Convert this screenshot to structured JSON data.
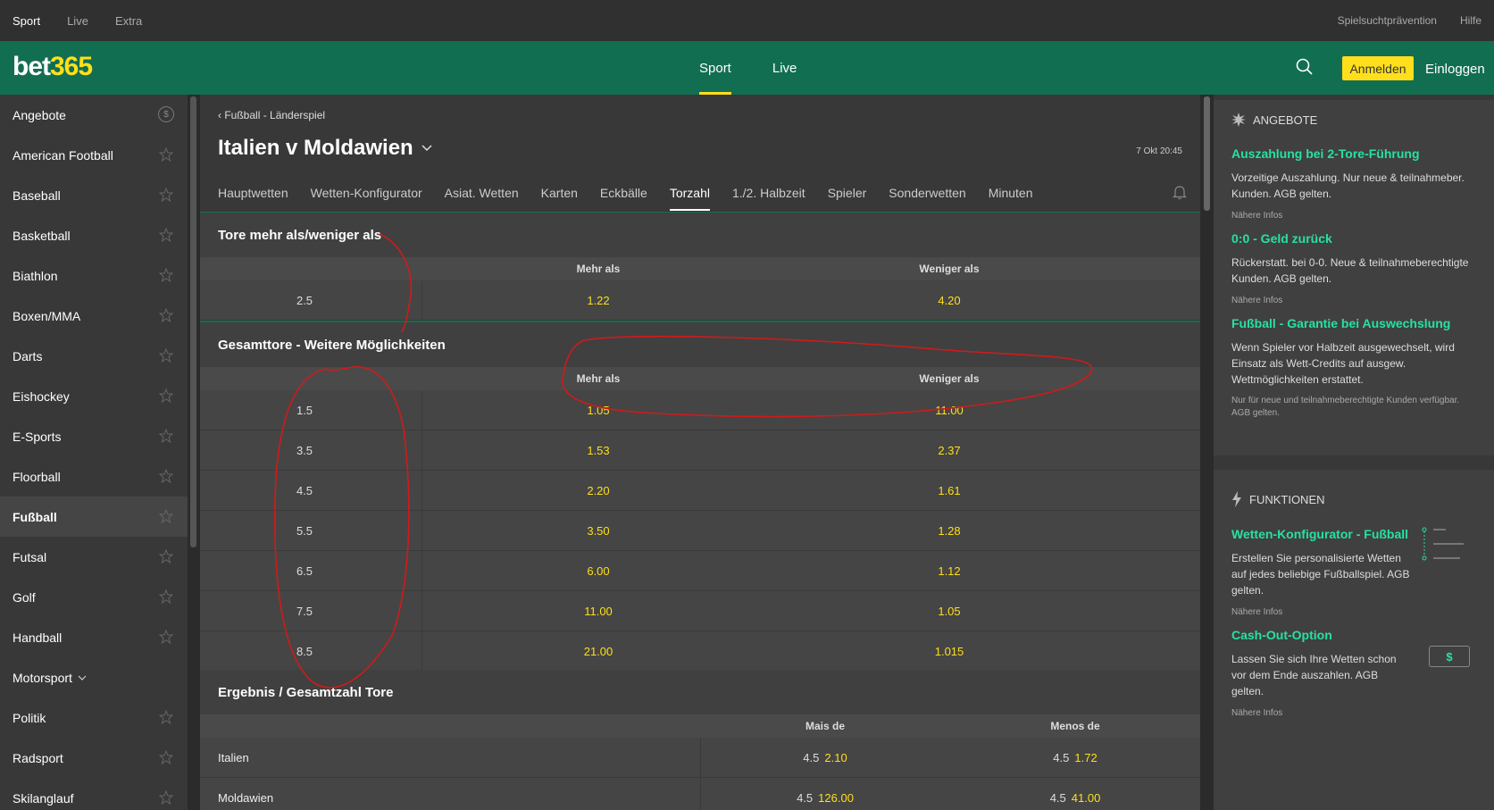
{
  "topbar": {
    "left": [
      "Sport",
      "Live",
      "Extra"
    ],
    "right": [
      "Spielsuchtprävention",
      "Hilfe"
    ]
  },
  "header": {
    "logo_a": "bet",
    "logo_b": "365",
    "nav": [
      "Sport",
      "Live"
    ],
    "register_label": "Anmelden",
    "login_label": "Einloggen"
  },
  "sidebar": {
    "items": [
      "Angebote",
      "American Football",
      "Baseball",
      "Basketball",
      "Biathlon",
      "Boxen/MMA",
      "Darts",
      "Eishockey",
      "E-Sports",
      "Floorball",
      "Fußball",
      "Futsal",
      "Golf",
      "Handball",
      "Motorsport",
      "Politik",
      "Radsport",
      "Skilanglauf"
    ],
    "offers_badge": "$"
  },
  "main": {
    "breadcrumb": "Fußball - Länderspiel",
    "title": "Italien v Moldawien",
    "time": "7 Okt 20:45",
    "tabs": [
      "Hauptwetten",
      "Wetten-Konfigurator",
      "Asiat. Wetten",
      "Karten",
      "Eckbälle",
      "Torzahl",
      "1./2. Halbzeit",
      "Spieler",
      "Sonderwetten",
      "Minuten"
    ]
  },
  "market1": {
    "title": "Tore mehr als/weniger als",
    "col_over": "Mehr als",
    "col_under": "Weniger als",
    "rows": [
      {
        "line": "2.5",
        "over": "1.22",
        "under": "4.20"
      }
    ]
  },
  "market2": {
    "title": "Gesamttore - Weitere Möglichkeiten",
    "col_over": "Mehr als",
    "col_under": "Weniger als",
    "rows": [
      {
        "line": "1.5",
        "over": "1.05",
        "under": "11.00"
      },
      {
        "line": "3.5",
        "over": "1.53",
        "under": "2.37"
      },
      {
        "line": "4.5",
        "over": "2.20",
        "under": "1.61"
      },
      {
        "line": "5.5",
        "over": "3.50",
        "under": "1.28"
      },
      {
        "line": "6.5",
        "over": "6.00",
        "under": "1.12"
      },
      {
        "line": "7.5",
        "over": "11.00",
        "under": "1.05"
      },
      {
        "line": "8.5",
        "over": "21.00",
        "under": "1.015"
      }
    ]
  },
  "market3": {
    "title": "Ergebnis / Gesamtzahl Tore",
    "col_over": "Mais de",
    "col_under": "Menos de",
    "rows": [
      {
        "team": "Italien",
        "over_h": "4.5",
        "over_o": "2.10",
        "under_h": "4.5",
        "under_o": "1.72"
      },
      {
        "team": "Moldawien",
        "over_h": "4.5",
        "over_o": "126.00",
        "under_h": "4.5",
        "under_o": "41.00"
      }
    ]
  },
  "right": {
    "offers_heading": "ANGEBOTE",
    "offers": [
      {
        "title": "Auszahlung bei 2-Tore-Führung",
        "desc": "Vorzeitige Auszahlung. Nur neue & teilnahmeber. Kunden. AGB gelten.",
        "more": "Nähere Infos"
      },
      {
        "title": "0:0 - Geld zurück",
        "desc": "Rückerstatt. bei 0-0. Neue & teilnahmeberechtigte Kunden. AGB gelten.",
        "more": "Nähere Infos"
      },
      {
        "title": "Fußball - Garantie bei Auswechslung",
        "desc": "Wenn Spieler vor Halbzeit ausgewechselt, wird Einsatz als Wett-Credits auf ausgew. Wettmöglichkeiten erstattet.",
        "small": "Nur für neue und teilnahmeberechtigte Kunden verfügbar. AGB gelten."
      }
    ],
    "functions_heading": "FUNKTIONEN",
    "functions": [
      {
        "title": "Wetten-Konfigurator - Fußball",
        "desc": "Erstellen Sie personalisierte Wetten auf jedes beliebige Fußballspiel. AGB gelten.",
        "more": "Nähere Infos"
      },
      {
        "title": "Cash-Out-Option",
        "desc": "Lassen Sie sich Ihre Wetten schon vor dem Ende auszahlen. AGB gelten.",
        "more": "Nähere Infos",
        "icon_text": "$"
      }
    ]
  },
  "colors": {
    "accent": "#ffdf1b",
    "brand": "#126e51",
    "link": "#26e1a2",
    "annotation": "#d11a1a"
  }
}
